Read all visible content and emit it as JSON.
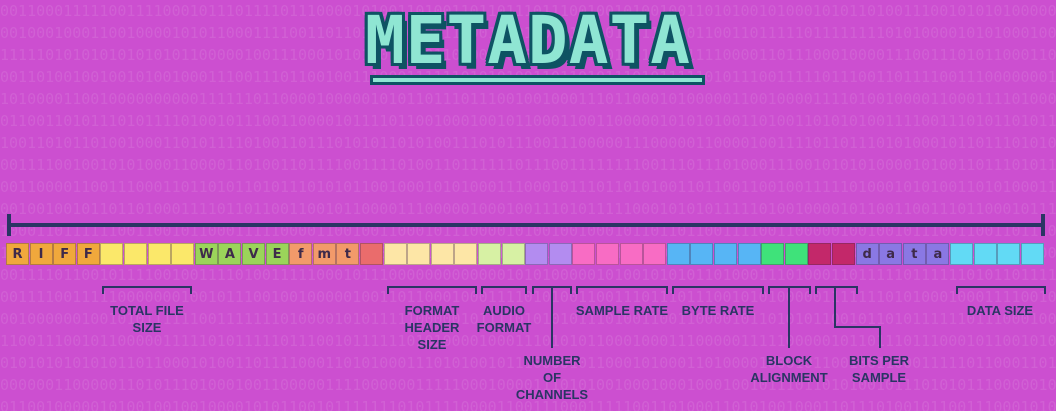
{
  "title": "METADATA",
  "colors": {
    "background": "#cc4fd0",
    "title_fill": "#8fe6d3",
    "title_outline": "#0e5363",
    "line": "#2a3564"
  },
  "cells": [
    {
      "text": "R",
      "color": "#f0a83c"
    },
    {
      "text": "I",
      "color": "#f0a83c"
    },
    {
      "text": "F",
      "color": "#f0a83c"
    },
    {
      "text": "F",
      "color": "#f0a83c"
    },
    {
      "text": "",
      "color": "#fbe86a"
    },
    {
      "text": "",
      "color": "#fbe86a"
    },
    {
      "text": "",
      "color": "#fbe86a"
    },
    {
      "text": "",
      "color": "#fbe86a"
    },
    {
      "text": "W",
      "color": "#9bd45a"
    },
    {
      "text": "A",
      "color": "#9bd45a"
    },
    {
      "text": "V",
      "color": "#9bd45a"
    },
    {
      "text": "E",
      "color": "#9bd45a"
    },
    {
      "text": "f",
      "color": "#f29a6a"
    },
    {
      "text": "m",
      "color": "#f29a6a"
    },
    {
      "text": "t",
      "color": "#f29a6a"
    },
    {
      "text": "",
      "color": "#ea6c6c"
    },
    {
      "text": "",
      "color": "#fde6a6"
    },
    {
      "text": "",
      "color": "#fde6a6"
    },
    {
      "text": "",
      "color": "#fde6a6"
    },
    {
      "text": "",
      "color": "#fde6a6"
    },
    {
      "text": "",
      "color": "#d7f1a4"
    },
    {
      "text": "",
      "color": "#d7f1a4"
    },
    {
      "text": "",
      "color": "#b38cf0"
    },
    {
      "text": "",
      "color": "#b38cf0"
    },
    {
      "text": "",
      "color": "#f86cc4"
    },
    {
      "text": "",
      "color": "#f86cc4"
    },
    {
      "text": "",
      "color": "#f86cc4"
    },
    {
      "text": "",
      "color": "#f86cc4"
    },
    {
      "text": "",
      "color": "#57b5f5"
    },
    {
      "text": "",
      "color": "#57b5f5"
    },
    {
      "text": "",
      "color": "#57b5f5"
    },
    {
      "text": "",
      "color": "#57b5f5"
    },
    {
      "text": "",
      "color": "#3fe27a"
    },
    {
      "text": "",
      "color": "#3fe27a"
    },
    {
      "text": "",
      "color": "#c3286a"
    },
    {
      "text": "",
      "color": "#c3286a"
    },
    {
      "text": "d",
      "color": "#8a78e4"
    },
    {
      "text": "a",
      "color": "#8a78e4"
    },
    {
      "text": "t",
      "color": "#8a78e4"
    },
    {
      "text": "a",
      "color": "#8a78e4"
    },
    {
      "text": "",
      "color": "#62daf5"
    },
    {
      "text": "",
      "color": "#62daf5"
    },
    {
      "text": "",
      "color": "#62daf5"
    },
    {
      "text": "",
      "color": "#62daf5"
    }
  ],
  "fields": [
    {
      "id": "total-file-size",
      "label": "TOTAL FILE\nSIZE"
    },
    {
      "id": "format-header-size",
      "label": "FORMAT\nHEADER\nSIZE"
    },
    {
      "id": "audio-format",
      "label": "AUDIO\nFORMAT"
    },
    {
      "id": "number-of-channels",
      "label": "NUMBER\nOF\nCHANNELS"
    },
    {
      "id": "sample-rate",
      "label": "SAMPLE RATE"
    },
    {
      "id": "byte-rate",
      "label": "BYTE RATE"
    },
    {
      "id": "block-alignment",
      "label": "BLOCK\nALIGNMENT"
    },
    {
      "id": "bits-per-sample",
      "label": "BITS PER\nSAMPLE"
    },
    {
      "id": "data-size",
      "label": "DATA SIZE"
    }
  ]
}
